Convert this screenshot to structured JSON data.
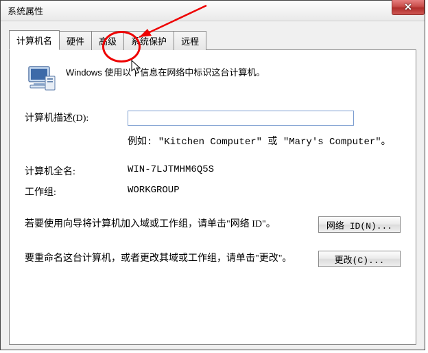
{
  "window": {
    "title": "系统属性"
  },
  "tabs": {
    "t0": "计算机名",
    "t1": "硬件",
    "t2": "高级",
    "t3": "系统保护",
    "t4": "远程"
  },
  "intro": "Windows 使用以下信息在网络中标识这台计算机。",
  "form": {
    "desc_label": "计算机描述(D):",
    "desc_value": "",
    "example": "例如: \"Kitchen Computer\" 或 \"Mary's Computer\"。",
    "fullname_label": "计算机全名:",
    "fullname_value": "WIN-7LJTMHM6Q5S",
    "workgroup_label": "工作组:",
    "workgroup_value": "WORKGROUP"
  },
  "para1": "若要使用向导将计算机加入域或工作组，请单击\"网络 ID\"。",
  "para2": "要重命名这台计算机，或者更改其域或工作组，请单击\"更改\"。",
  "buttons": {
    "network_id": "网络 ID(N)...",
    "change": "更改(C)..."
  }
}
